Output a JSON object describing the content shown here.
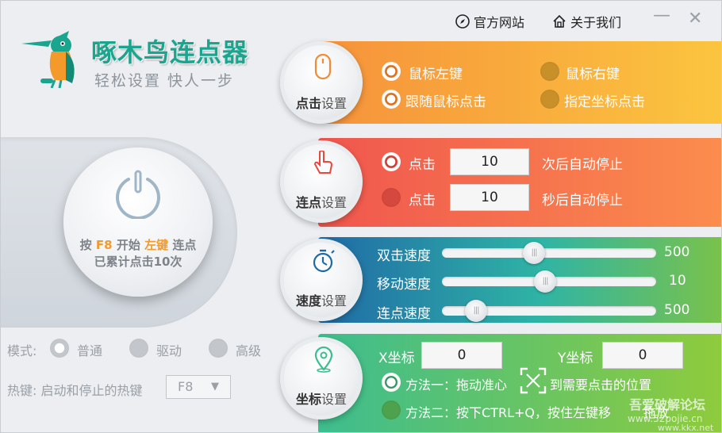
{
  "app": {
    "title": "啄木鸟连点器",
    "slogan": "轻松设置  快人一步",
    "links": {
      "official_site": "官方网站",
      "about_us": "关于我们"
    },
    "window_controls": {
      "minimize": "—",
      "close": "✕"
    }
  },
  "status": {
    "prefix": "按",
    "hotkey": "F8",
    "middle": "开始",
    "button": "左键",
    "suffix": "连点",
    "count_text": "已累计点击10次"
  },
  "mode": {
    "label": "模式:",
    "options": [
      "普通",
      "驱动",
      "高级"
    ],
    "selected": "普通"
  },
  "hotkey": {
    "label": "热键: 启动和停止的热键",
    "value": "F8",
    "arrow": "▼"
  },
  "click_settings": {
    "title_main": "点击",
    "title_rest": "设置",
    "options": [
      "鼠标左键",
      "鼠标右键",
      "跟随鼠标点击",
      "指定坐标点击"
    ]
  },
  "repeat_settings": {
    "title_main": "连点",
    "title_rest": "设置",
    "row1": {
      "prefix": "点击",
      "value": "10",
      "suffix": "次后自动停止"
    },
    "row2": {
      "prefix": "点击",
      "value": "10",
      "suffix": "秒后自动停止"
    }
  },
  "speed_settings": {
    "title_main": "速度",
    "title_rest": "设置",
    "sliders": [
      {
        "label": "双击速度",
        "value": "500",
        "fraction": 0.42
      },
      {
        "label": "移动速度",
        "value": "10",
        "fraction": 0.48
      },
      {
        "label": "连点速度",
        "value": "500",
        "fraction": 0.12
      }
    ]
  },
  "coord_settings": {
    "title_main": "坐标",
    "title_rest": "设置",
    "x_label": "X坐标",
    "x_value": "0",
    "y_label": "Y坐标",
    "y_value": "0",
    "method1": {
      "prefix": "方法一：拖动准心",
      "suffix": "到需要点击的位置"
    },
    "method2": "方法二：按下CTRL+Q，按住左键移",
    "method2_tail": "拖放"
  },
  "watermark": {
    "forum": "吾爱破解论坛",
    "site": "www.52pojie.cn",
    "site2": "www.kkx.net"
  },
  "colors": {
    "brand": "#1aa58f",
    "highlight": "#f39a2b",
    "click_panel": "#f6923b",
    "repeat_panel": "#f0564e",
    "speed_panel": "#1f6aa6",
    "coord_panel": "#3dbd8f"
  }
}
